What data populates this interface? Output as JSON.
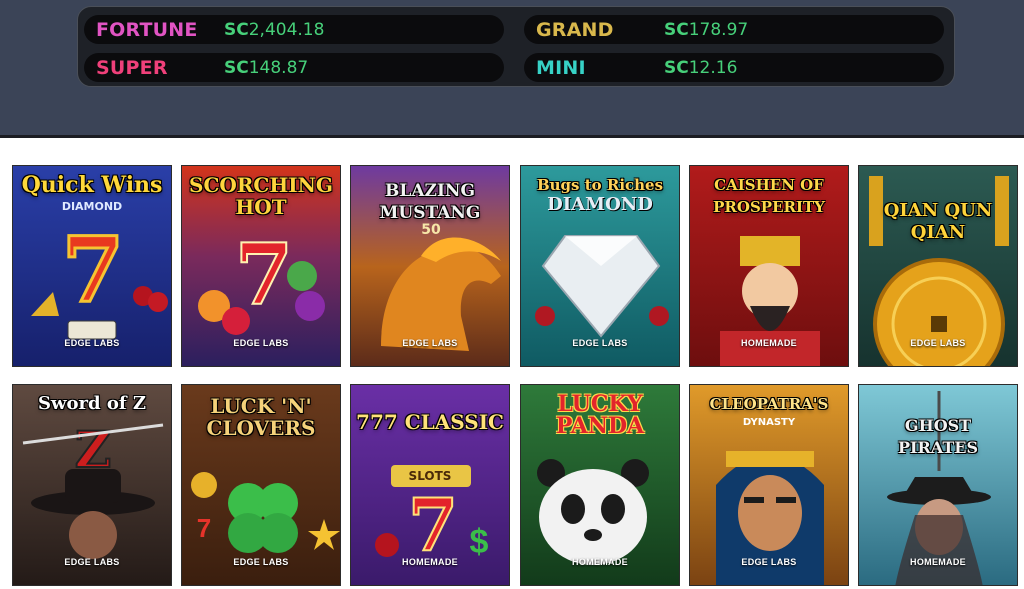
{
  "jackpots": [
    {
      "name": "FORTUNE",
      "currency": "SC",
      "amount": "2,404.18",
      "color": "#e154c3"
    },
    {
      "name": "GRAND",
      "currency": "SC",
      "amount": "178.97",
      "color": "#d9b84c"
    },
    {
      "name": "SUPER",
      "currency": "SC",
      "amount": "148.87",
      "color": "#f0407a"
    },
    {
      "name": "MINI",
      "currency": "SC",
      "amount": "12.16",
      "color": "#37d2c6"
    }
  ],
  "games": [
    {
      "title": "Quick Wins",
      "subtitle": "DIAMOND",
      "provider": "EDGE LABS",
      "art": "seven-icon"
    },
    {
      "title": "SCORCHING HOT",
      "subtitle": "",
      "provider": "EDGE LABS",
      "art": "seven-icon"
    },
    {
      "title": "BLAZING MUSTANG",
      "subtitle": "50",
      "provider": "EDGE LABS",
      "art": "horse-icon"
    },
    {
      "title": "Bugs to Riches",
      "subtitle": "DIAMOND",
      "provider": "EDGE LABS",
      "art": "diamond-icon"
    },
    {
      "title": "CAISHEN OF PROSPERITY",
      "subtitle": "",
      "provider": "HOMEMADE",
      "art": "caishen-icon"
    },
    {
      "title": "QIAN QUN QIAN",
      "subtitle": "",
      "provider": "EDGE LABS",
      "art": "coin-icon"
    },
    {
      "title": "Sword of Z",
      "subtitle": "",
      "provider": "EDGE LABS",
      "art": "zorro-icon"
    },
    {
      "title": "LUCK 'N' CLOVERS",
      "subtitle": "",
      "provider": "EDGE LABS",
      "art": "clover-icon"
    },
    {
      "title": "777 CLASSIC",
      "subtitle": "SLOTS",
      "provider": "HOMEMADE",
      "art": "seven-icon"
    },
    {
      "title": "LUCKY PANDA",
      "subtitle": "",
      "provider": "HOMEMADE",
      "art": "panda-icon"
    },
    {
      "title": "CLEOPATRA'S",
      "subtitle": "DYNASTY",
      "provider": "EDGE LABS",
      "art": "cleopatra-icon"
    },
    {
      "title": "GHOST PIRATES",
      "subtitle": "",
      "provider": "HOMEMADE",
      "art": "pirate-icon"
    }
  ]
}
